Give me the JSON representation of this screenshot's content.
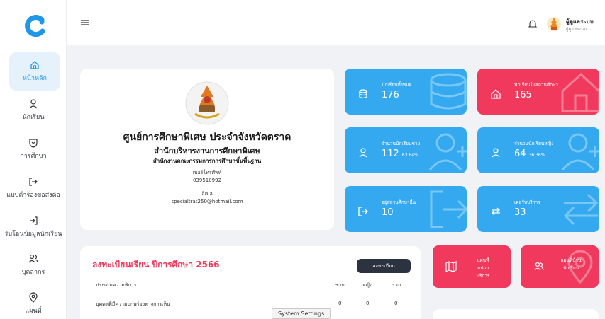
{
  "sidebar": {
    "items": [
      {
        "label": "หน้าหลัก"
      },
      {
        "label": "นักเรียน"
      },
      {
        "label": "การศึกษา"
      },
      {
        "label": "แบบคำร้องขอส่งต่อ"
      },
      {
        "label": "รับโอนข้อมูลนักเรียน"
      },
      {
        "label": "บุคลากร"
      },
      {
        "label": "แผนที่"
      }
    ]
  },
  "header": {
    "user_name": "ผู้ดูแลระบบ",
    "user_role": "ผู้ดูแลระบบ ⌄"
  },
  "school": {
    "name": "ศูนย์การศึกษาพิเศษ ประจำจังหวัดตราด",
    "sub1": "สำนักบริหารงานการศึกษาพิเศษ",
    "sub2": "สำนักงานคณะกรรมการการศึกษาขั้นพื้นฐาน",
    "phone_label": "เบอร์โทรศัพท์",
    "phone": "039510992",
    "email_label": "อีเมล",
    "email": "specialtrat250@hotmail.com"
  },
  "stats": [
    {
      "label": "นักเรียนทั้งหมด",
      "value": "176",
      "pct": ""
    },
    {
      "label": "นักเรียนในสถานศึกษา",
      "value": "165",
      "pct": ""
    },
    {
      "label": "จำนวนนักเรียนชาย",
      "value": "112",
      "pct": "63.64%"
    },
    {
      "label": "จำนวนนักเรียนหญิง",
      "value": "64",
      "pct": "36.36%"
    },
    {
      "label": "อยู่สถานศึกษาอื่น",
      "value": "10",
      "pct": ""
    },
    {
      "label": "เคยรับบริการ",
      "value": "33",
      "pct": ""
    }
  ],
  "registration": {
    "title": "ลงทะเบียนเรียน ปีการศึกษา 2566",
    "button": "ลงทะเบียน",
    "columns": [
      "ประเภทความพิการ",
      "ชาย",
      "หญิง",
      "รวม"
    ],
    "rows": [
      {
        "type": "บุคคลที่มีความบกพร่องทางการเห็น",
        "male": "0",
        "female": "0",
        "total": "0"
      }
    ]
  },
  "mini_cards": [
    {
      "line1": "แผนที่",
      "line2": "หน่วย",
      "line3": "บริการ"
    },
    {
      "line1": "แผนที่บ้าน",
      "line2": "นักเรียน",
      "line3": ""
    }
  ],
  "tooltip": "System Settings",
  "colors": {
    "primary": "#34a9f0",
    "accent": "#f0395c",
    "dark": "#2c3340"
  }
}
